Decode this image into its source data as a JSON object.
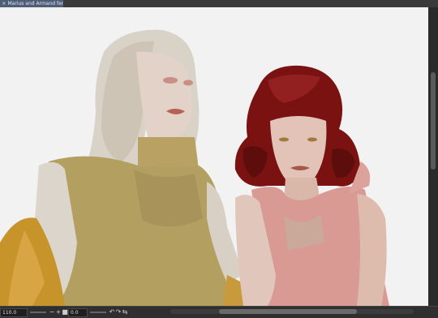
{
  "document_tab": {
    "title": "Marius and Armand fem*",
    "close_icon": "close-icon"
  },
  "status_bar": {
    "zoom_value": "110.0",
    "zoom_out_symbol": "−",
    "zoom_in_symbol": "+",
    "rotation_value": "0.0"
  },
  "colors": {
    "canvas_bg": "#f2f2f3",
    "tab_active": "#4e5d78"
  }
}
